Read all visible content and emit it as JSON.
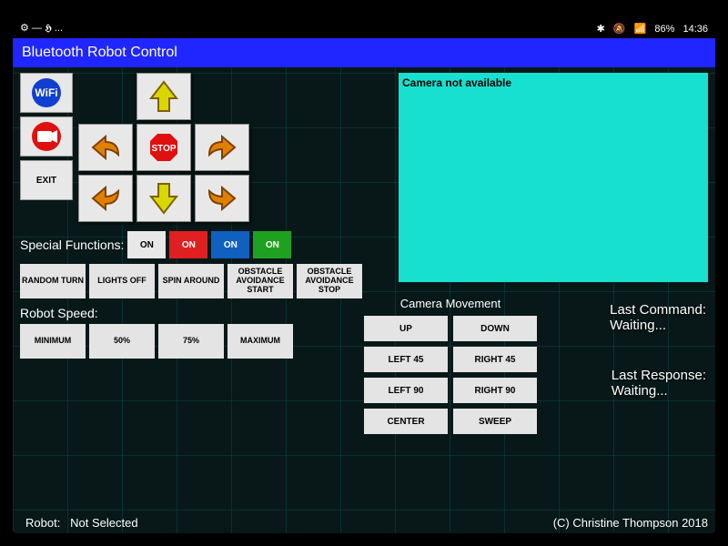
{
  "statusbar": {
    "left": "⚙ — 𝕳 ...",
    "bt": "✱",
    "mute": "🔕",
    "sig": "📶",
    "battery": "86%",
    "time": "14:36"
  },
  "title": "Bluetooth Robot Control",
  "leftbuttons": {
    "exit": "EXIT"
  },
  "dpad": {
    "stop": "STOP"
  },
  "camera_text": "Camera not available",
  "special_label": "Special Functions:",
  "toggles": [
    "ON",
    "ON",
    "ON",
    "ON"
  ],
  "functions": [
    "RANDOM TURN",
    "LIGHTS OFF",
    "SPIN AROUND",
    "OBSTACLE AVOIDANCE START",
    "OBSTACLE AVOIDANCE STOP"
  ],
  "speed_label": "Robot Speed:",
  "speeds": [
    "MINIMUM",
    "50%",
    "75%",
    "MAXIMUM"
  ],
  "cam_header": "Camera Movement",
  "cam_buttons": [
    "UP",
    "DOWN",
    "LEFT 45",
    "RIGHT 45",
    "LEFT 90",
    "RIGHT 90",
    "CENTER",
    "SWEEP"
  ],
  "last_cmd_label": "Last Command:",
  "last_cmd_val": "Waiting...",
  "last_resp_label": "Last Response:",
  "last_resp_val": "Waiting...",
  "robot_label": "Robot:",
  "robot_val": "Not Selected",
  "copyright": "(C) Christine Thompson 2018"
}
